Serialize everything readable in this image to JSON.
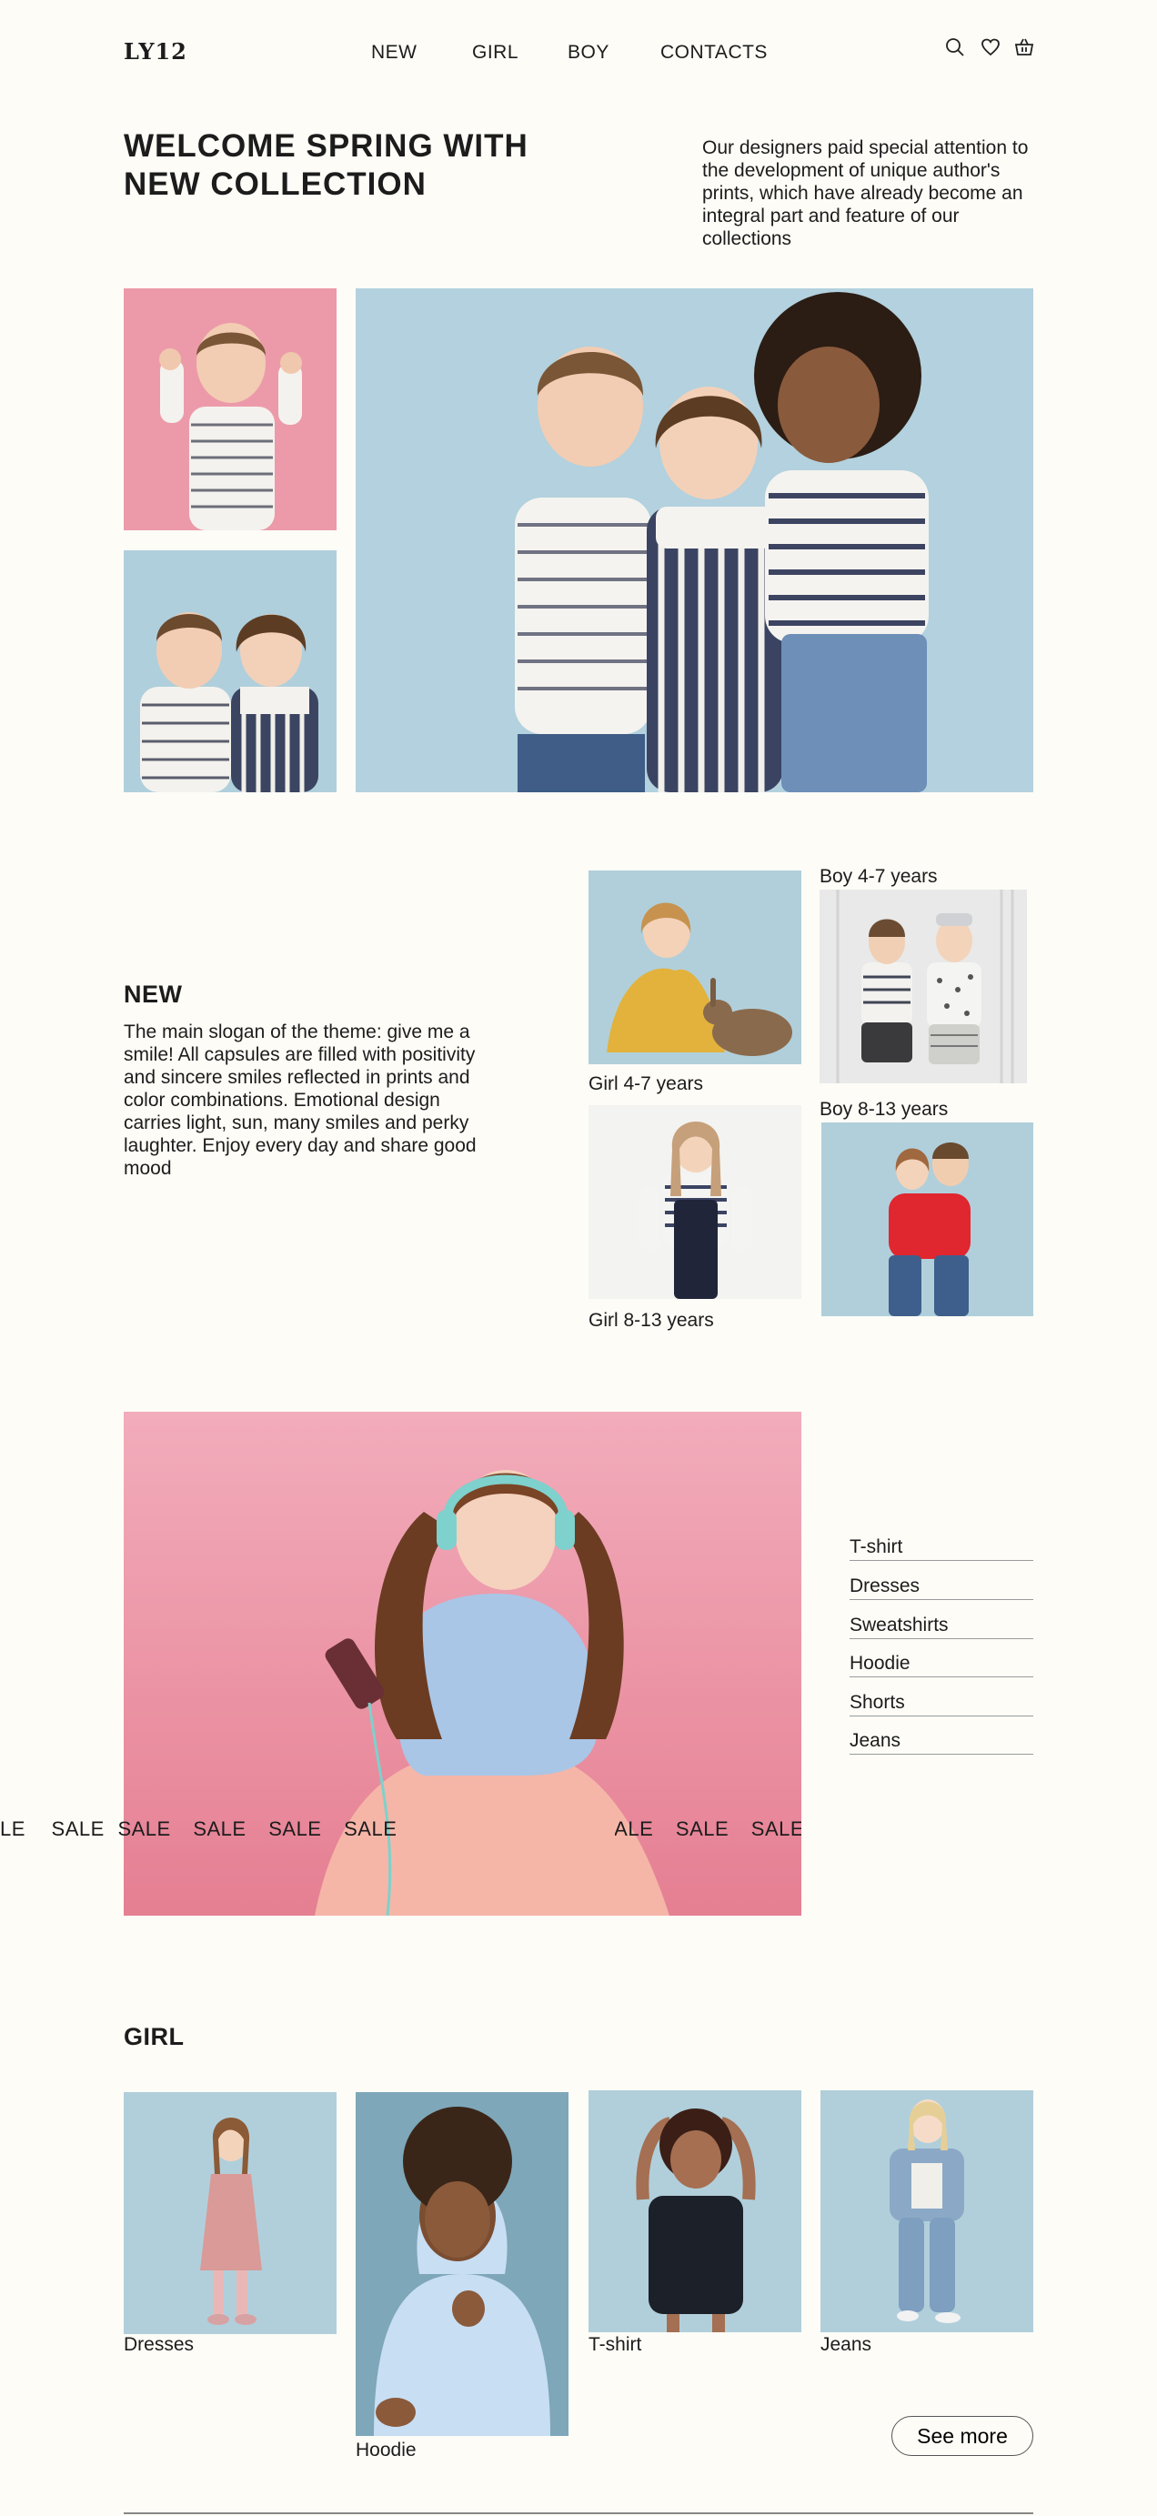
{
  "header": {
    "logo": "LY12",
    "nav": [
      "NEW",
      "GIRL",
      "BOY",
      "CONTACTS"
    ],
    "icons": [
      "search-icon",
      "heart-icon",
      "basket-icon"
    ]
  },
  "hero": {
    "title_line1": "WELCOME SPRING WITH",
    "title_line2": "NEW COLLECTION",
    "description": "Our designers paid special attention to the development of unique author's prints, which have already become an integral part and feature of our collections"
  },
  "new_section": {
    "title": "NEW",
    "text": "The main slogan of the theme: give me a smile! All capsules are filled with positivity and sincere smiles reflected in prints and color combinations. Emotional design carries light, sun, many smiles and perky laughter. Enjoy every day and share good mood",
    "categories": {
      "girl_4_7": "Girl  4-7 years",
      "boy_4_7": "Boy  4-7 years",
      "girl_8_13": "Girl  8-13 years",
      "boy_8_13": "Boy  8-13 years"
    }
  },
  "sale": {
    "left": [
      "LE",
      "SALE",
      "SALE",
      "SALE",
      "SALE",
      "SALE"
    ],
    "right": [
      "SALE",
      "SALE",
      "SALE"
    ],
    "menu": [
      "T-shirt",
      "Dresses",
      "Sweatshirts",
      "Hoodie",
      "Shorts",
      "Jeans"
    ]
  },
  "girl_section": {
    "title": "GIRL",
    "products": [
      "Dresses",
      "Hoodie",
      "T-shirt",
      "Jeans"
    ],
    "see_more": "See more"
  },
  "colors": {
    "background": "#fdfcf7",
    "pink": "#e8909f",
    "light_blue": "#b3d0dd",
    "text": "#1c1c1c"
  }
}
